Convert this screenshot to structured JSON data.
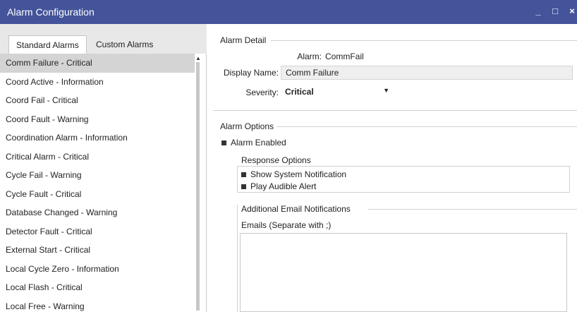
{
  "window": {
    "title": "Alarm Configuration",
    "controls": {
      "minimize": "_",
      "maximize": "□",
      "close": "×"
    }
  },
  "tabs": [
    {
      "label": "Standard Alarms",
      "active": true
    },
    {
      "label": "Custom Alarms",
      "active": false
    }
  ],
  "alarms": [
    {
      "label": "Comm Failure - Critical",
      "selected": true
    },
    {
      "label": "Coord Active - Information"
    },
    {
      "label": "Coord Fail - Critical"
    },
    {
      "label": "Coord Fault - Warning"
    },
    {
      "label": "Coordination Alarm - Information"
    },
    {
      "label": "Critical Alarm - Critical"
    },
    {
      "label": "Cycle Fail - Warning"
    },
    {
      "label": "Cycle Fault - Critical"
    },
    {
      "label": "Database Changed - Warning"
    },
    {
      "label": "Detector Fault - Critical"
    },
    {
      "label": "External Start - Critical"
    },
    {
      "label": "Local Cycle Zero - Information"
    },
    {
      "label": "Local Flash - Critical"
    },
    {
      "label": "Local Free - Warning"
    }
  ],
  "detail": {
    "group_title": "Alarm Detail",
    "alarm_label": "Alarm:",
    "alarm_value": "CommFail",
    "display_name_label": "Display Name:",
    "display_name_value": "Comm Failure",
    "severity_label": "Severity:",
    "severity_value": "Critical"
  },
  "options": {
    "group_title": "Alarm Options",
    "alarm_enabled": "Alarm Enabled",
    "response_title": "Response Options",
    "show_notification": "Show System Notification",
    "play_alert": "Play Audible Alert",
    "email_group_title": "Additional Email Notifications",
    "emails_label": "Emails (Separate with ;)",
    "emails_value": ""
  },
  "colors": {
    "titlebar": "#43549a",
    "selected_row": "#d4d4d4",
    "tab_strip": "#e8e8e8"
  }
}
